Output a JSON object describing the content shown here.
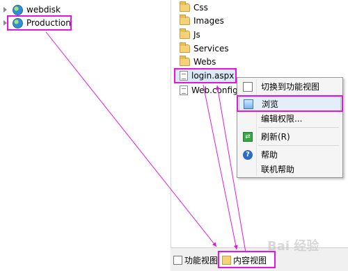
{
  "tree": {
    "items": [
      {
        "label": "webdisk"
      },
      {
        "label": "Production"
      }
    ]
  },
  "files": [
    {
      "name": "Css",
      "type": "folder"
    },
    {
      "name": "Images",
      "type": "folder"
    },
    {
      "name": "Js",
      "type": "folder"
    },
    {
      "name": "Services",
      "type": "folder"
    },
    {
      "name": "Webs",
      "type": "folder"
    },
    {
      "name": "login.aspx",
      "type": "file"
    },
    {
      "name": "Web.config",
      "type": "file"
    }
  ],
  "context_menu": {
    "items": [
      {
        "label": "切换到功能视图",
        "icon": "feature-view-icon"
      },
      {
        "label": "浏览",
        "icon": "browse-icon"
      },
      {
        "label": "编辑权限...",
        "icon": ""
      },
      {
        "label": "刷新(R)",
        "icon": "refresh-icon"
      },
      {
        "label": "帮助",
        "icon": "help-icon"
      },
      {
        "label": "联机帮助",
        "icon": ""
      }
    ]
  },
  "bottom_tabs": [
    {
      "label": "功能视图"
    },
    {
      "label": "内容视图"
    }
  ],
  "watermark": "Bai 经验",
  "accent_color": "#e514e5"
}
